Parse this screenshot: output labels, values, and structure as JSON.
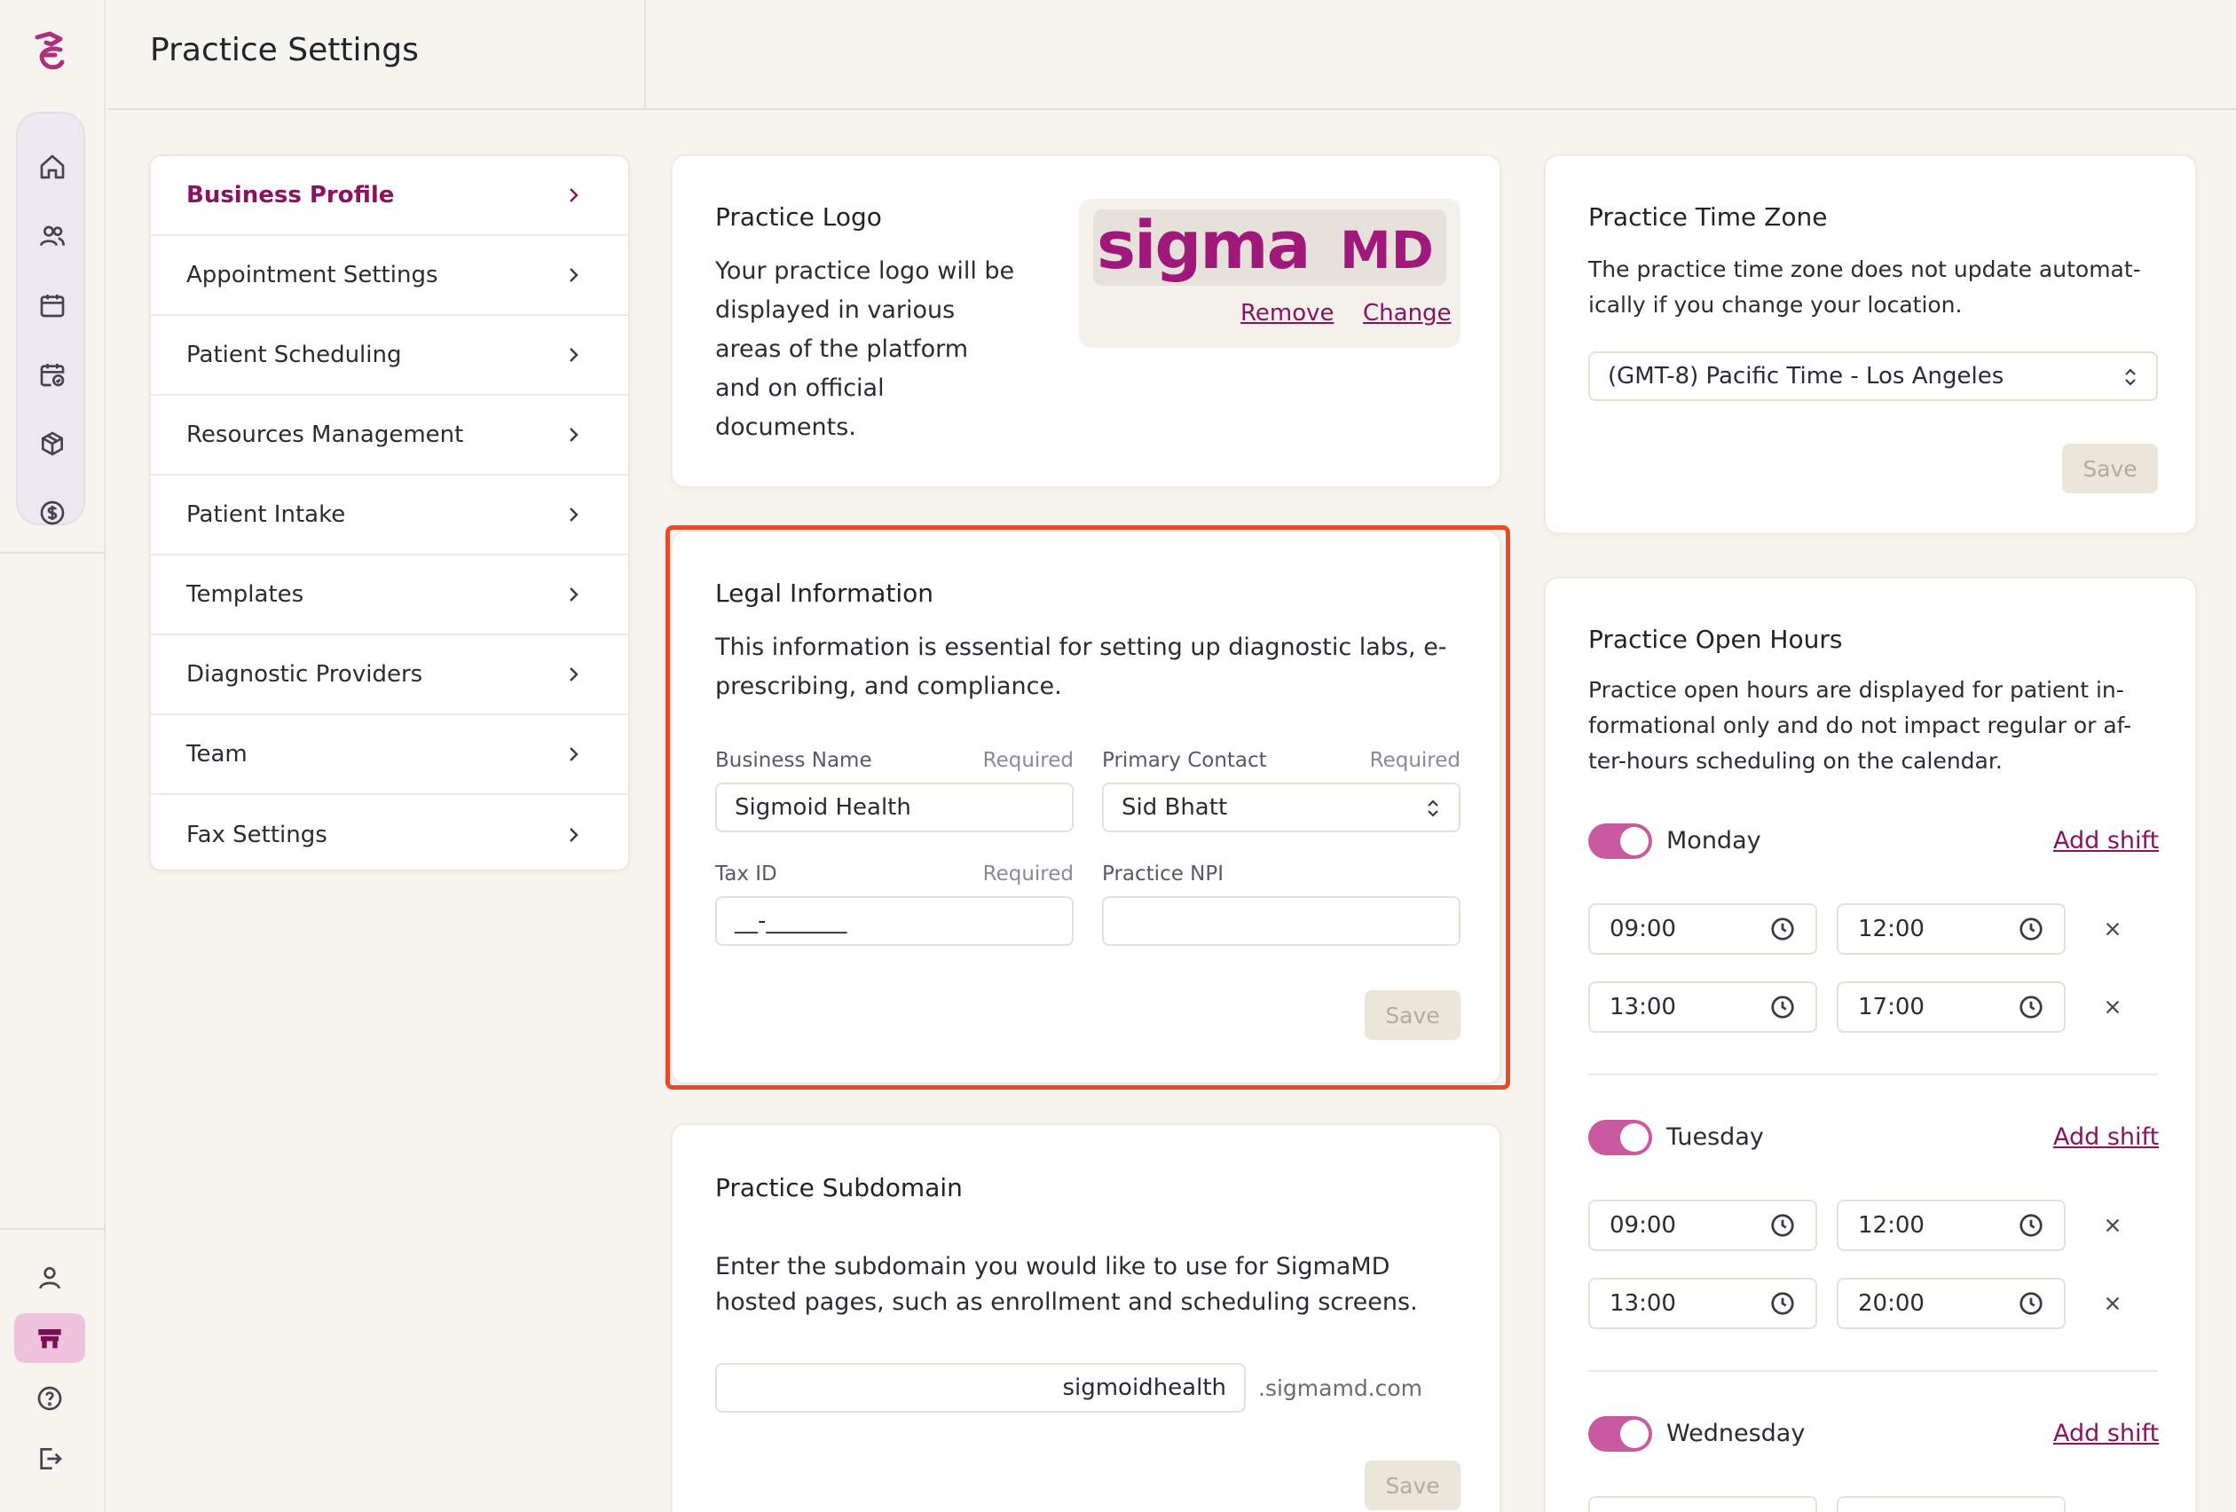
{
  "header": {
    "title": "Practice Settings"
  },
  "nav": {
    "items": [
      {
        "label": "Business Profile",
        "active": true
      },
      {
        "label": "Appointment Settings"
      },
      {
        "label": "Patient Scheduling"
      },
      {
        "label": "Resources Management"
      },
      {
        "label": "Patient Intake"
      },
      {
        "label": "Templates"
      },
      {
        "label": "Diagnostic Providers"
      },
      {
        "label": "Team"
      },
      {
        "label": "Fax Settings"
      }
    ]
  },
  "logo_card": {
    "title": "Practice Logo",
    "description": "Your practice logo will be displayed in various areas of the platform and on official documents.",
    "logo_text": "sigmaMD",
    "remove_label": "Remove",
    "change_label": "Change"
  },
  "legal_card": {
    "title": "Legal Information",
    "description": "This information is essential for setting up diagnostic labs, e-prescribing, and compliance.",
    "business_name_label": "Business Name",
    "business_name_required": "Required",
    "business_name_value": "Sigmoid Health",
    "primary_contact_label": "Primary Contact",
    "primary_contact_required": "Required",
    "primary_contact_value": "Sid Bhatt",
    "tax_id_label": "Tax ID",
    "tax_id_required": "Required",
    "tax_id_value": "__-_______",
    "npi_label": "Practice NPI",
    "npi_value": "",
    "save_label": "Save"
  },
  "subdomain_card": {
    "title": "Practice Subdomain",
    "description": "Enter the subdomain you would like to use for SigmaMD hosted pages, such as enrollment and scheduling screens.",
    "subdomain_value": "sigmoidhealth",
    "suffix": ".sigmamd.com",
    "save_label": "Save"
  },
  "timezone_card": {
    "title": "Practice Time Zone",
    "description": "The practice time zone does not update automat-ically if you change your location.",
    "timezone_value": "(GMT-8) Pacific Time - Los Angeles",
    "save_label": "Save"
  },
  "hours_card": {
    "title": "Practice Open Hours",
    "description": "Practice open hours are displayed for patient in-formational only and do not impact regular or af-ter-hours scheduling on the calendar.",
    "add_shift_label": "Add shift",
    "days": [
      {
        "name": "Monday",
        "enabled": true,
        "shifts": [
          {
            "start": "09:00",
            "end": "12:00"
          },
          {
            "start": "13:00",
            "end": "17:00"
          }
        ]
      },
      {
        "name": "Tuesday",
        "enabled": true,
        "shifts": [
          {
            "start": "09:00",
            "end": "12:00"
          },
          {
            "start": "13:00",
            "end": "20:00"
          }
        ]
      },
      {
        "name": "Wednesday",
        "enabled": true,
        "shifts": []
      }
    ]
  },
  "colors": {
    "accent": "#8a1262",
    "toggle": "#c95aa0",
    "highlight": "#ea4a2a",
    "background": "#f6f4ef"
  }
}
